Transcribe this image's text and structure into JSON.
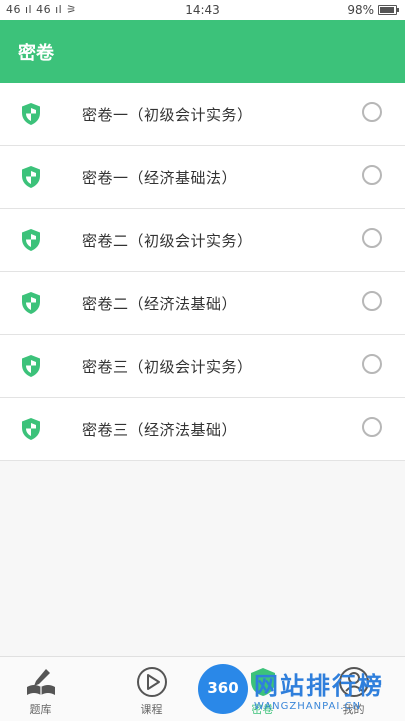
{
  "status_bar": {
    "signal": "46 ıl 46 ıl ⚞",
    "time": "14:43",
    "battery": "98%"
  },
  "app_bar": {
    "title": "密卷"
  },
  "items": [
    {
      "label": "密卷一（初级会计实务）"
    },
    {
      "label": "密卷一（经济基础法）"
    },
    {
      "label": "密卷二（初级会计实务）"
    },
    {
      "label": "密卷二（经济法基础）"
    },
    {
      "label": "密卷三（初级会计实务）"
    },
    {
      "label": "密卷三（经济法基础）"
    }
  ],
  "tabs": [
    {
      "label": "题库",
      "icon": "book-pen-icon"
    },
    {
      "label": "课程",
      "icon": "play-circle-icon"
    },
    {
      "label": "密卷",
      "icon": "shield-icon"
    },
    {
      "label": "我的",
      "icon": "user-icon"
    }
  ],
  "watermark": {
    "badge": "360",
    "brand": "网站排行榜",
    "site": "WANGZHANPAI.CN"
  },
  "colors": {
    "accent": "#3cc27a",
    "radio": "#b7b7b7"
  }
}
